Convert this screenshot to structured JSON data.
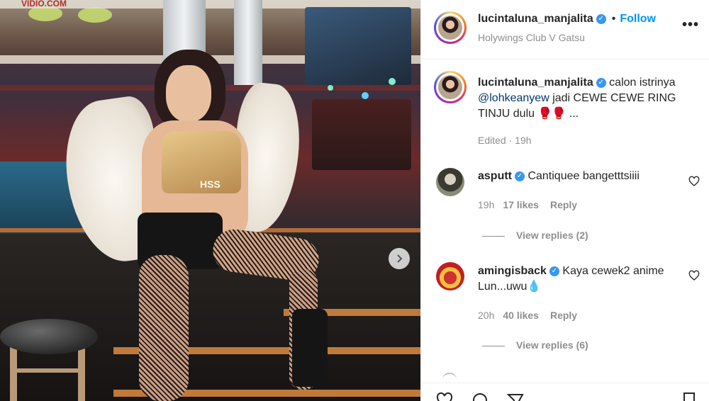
{
  "photo": {
    "banner_text": "VIDIO.COM",
    "shirt_text": "HSS",
    "next_icon": "chevron-right-icon"
  },
  "post": {
    "username": "lucintaluna_manjalita",
    "verified": true,
    "follow_label": "Follow",
    "location": "Holywings Club V Gatsu",
    "caption": {
      "username": "lucintaluna_manjalita",
      "text_before": "calon istrinya",
      "mention": "@lohkeanyew",
      "text_after": "jadi CEWE CEWE RING TINJU dulu 🥊🥊 ...",
      "edited": "Edited",
      "time": "19h"
    }
  },
  "comments": [
    {
      "username": "asputt",
      "verified": true,
      "text": "Cantiquee bangetttsiiii",
      "time": "19h",
      "likes": "17 likes",
      "reply_label": "Reply",
      "view_replies": "View replies (2)"
    },
    {
      "username": "amingisback",
      "verified": true,
      "text": "Kaya cewek2 anime Lun...uwu💧",
      "time": "20h",
      "likes": "40 likes",
      "reply_label": "Reply",
      "view_replies": "View replies (6)"
    }
  ],
  "colors": {
    "follow": "#0095f6",
    "verified": "#3897f0",
    "muted": "#8e8e8e",
    "text": "#262626"
  }
}
